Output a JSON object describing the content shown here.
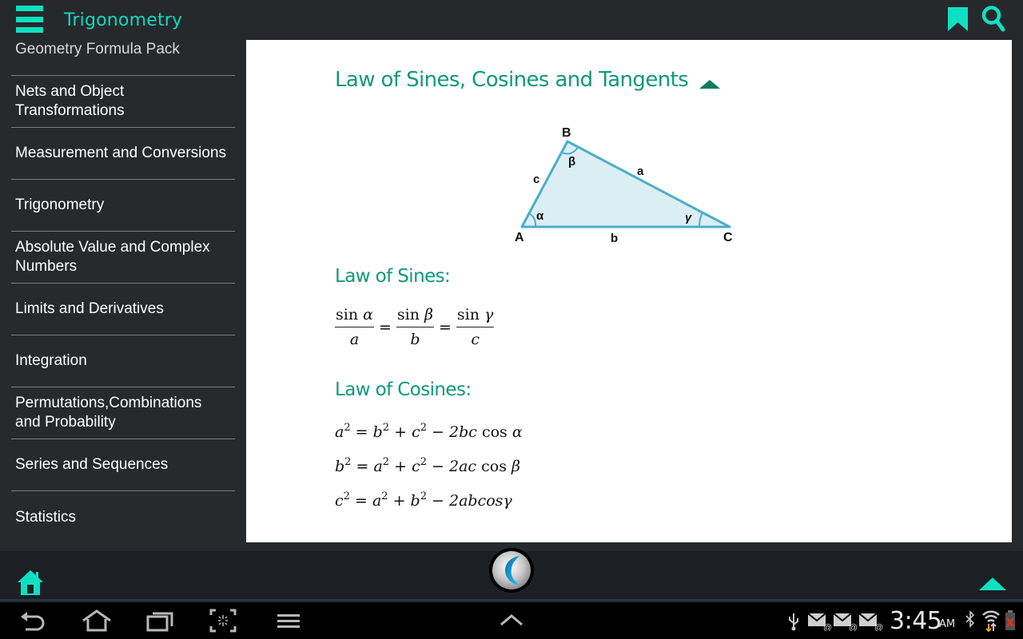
{
  "header": {
    "title": "Trigonometry",
    "menu_icon": "hamburger-menu-icon",
    "bookmark_icon": "bookmark-icon",
    "search_icon": "search-icon"
  },
  "sidebar": {
    "items": [
      {
        "label": "Geometry Formula Pack"
      },
      {
        "label": "Nets and Object Transformations"
      },
      {
        "label": "Measurement and Conversions"
      },
      {
        "label": "Trigonometry"
      },
      {
        "label": "Absolute Value and Complex Numbers"
      },
      {
        "label": "Limits and Derivatives"
      },
      {
        "label": "Integration"
      },
      {
        "label": "Permutations,Combinations and Probability"
      },
      {
        "label": "Series and Sequences"
      },
      {
        "label": "Statistics"
      }
    ]
  },
  "content": {
    "heading": "Law of Sines, Cosines and Tangents",
    "collapse_icon": "collapse-up-icon",
    "diagram": {
      "vertices": {
        "A": "A",
        "B": "B",
        "C": "C"
      },
      "sides": {
        "a": "a",
        "b": "b",
        "c": "c"
      },
      "angles": {
        "alpha": "α",
        "beta": "β",
        "gamma": "γ"
      },
      "fill_color": "#dbeef4",
      "stroke_color": "#4aaecb"
    },
    "sines": {
      "heading": "Law of Sines:",
      "terms": [
        {
          "num_fn": "sin",
          "num_var": "α",
          "den": "a"
        },
        {
          "num_fn": "sin",
          "num_var": "β",
          "den": "b"
        },
        {
          "num_fn": "sin",
          "num_var": "γ",
          "den": "c"
        }
      ],
      "equals": "="
    },
    "cosines": {
      "heading": "Law of Cosines:",
      "equations": [
        {
          "lhs": "a",
          "r1": "b",
          "r2": "c",
          "coef": "2bc",
          "fn": "cos",
          "angle": "α"
        },
        {
          "lhs": "b",
          "r1": "a",
          "r2": "c",
          "coef": "2ac",
          "fn": "cos",
          "angle": "β"
        },
        {
          "lhs": "c",
          "r1": "a",
          "r2": "b",
          "coef": "2abcos",
          "fn": "",
          "angle": "γ"
        }
      ],
      "exponent": "2"
    }
  },
  "bottom_bar": {
    "home_icon": "home-icon",
    "logo_icon": "app-logo-icon",
    "scroll_top_icon": "scroll-top-icon"
  },
  "system_bar": {
    "time": "3:45",
    "ampm": "AM",
    "nav": [
      "back-icon",
      "home-icon",
      "recent-apps-icon",
      "screenshot-icon",
      "menu-icon",
      "expand-up-icon"
    ],
    "status_icons": [
      "usb-icon",
      "email-icon",
      "email-icon",
      "email-icon",
      "bluetooth-icon",
      "wifi-icon",
      "battery-icon"
    ]
  },
  "colors": {
    "accent": "#10d9bd",
    "heading_green": "#0e9a78",
    "background": "#262a2d"
  }
}
